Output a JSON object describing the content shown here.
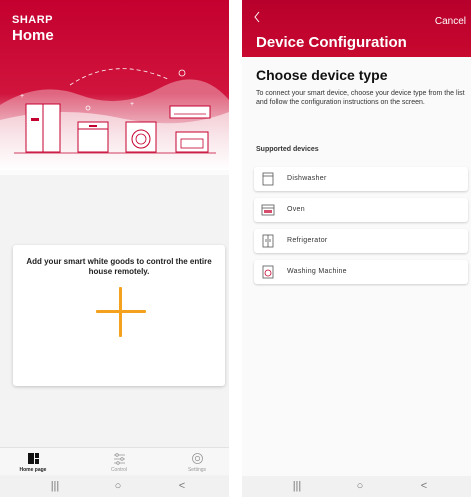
{
  "home_screen": {
    "brand": "SHARP",
    "title": "Home",
    "add_card_text": "Add your smart white goods to control the entire house remotely.",
    "add_icon": "plus-icon",
    "bottom_nav": [
      {
        "label": "Home page",
        "icon": "home-dashboard-icon",
        "active": true
      },
      {
        "label": "Control",
        "icon": "sliders-icon",
        "active": false
      },
      {
        "label": "Settings",
        "icon": "gear-icon",
        "active": false
      }
    ]
  },
  "config_screen": {
    "back_icon": "chevron-left-icon",
    "cancel_label": "Cancel",
    "title": "Device Configuration",
    "heading": "Choose device type",
    "description": "To connect your smart device, choose your device type from the list and follow the configuration instructions on the screen.",
    "supported_label": "Supported devices",
    "devices": [
      {
        "label": "Dishwasher",
        "icon": "dishwasher-icon"
      },
      {
        "label": "Oven",
        "icon": "oven-icon"
      },
      {
        "label": "Refrigerator",
        "icon": "refrigerator-icon"
      },
      {
        "label": "Washing Machine",
        "icon": "washing-machine-icon"
      }
    ]
  },
  "system_nav": {
    "recents": "|||",
    "home": "○",
    "back": "<"
  },
  "colors": {
    "brand_red": "#c4002f",
    "accent_orange": "#f4a21e"
  }
}
